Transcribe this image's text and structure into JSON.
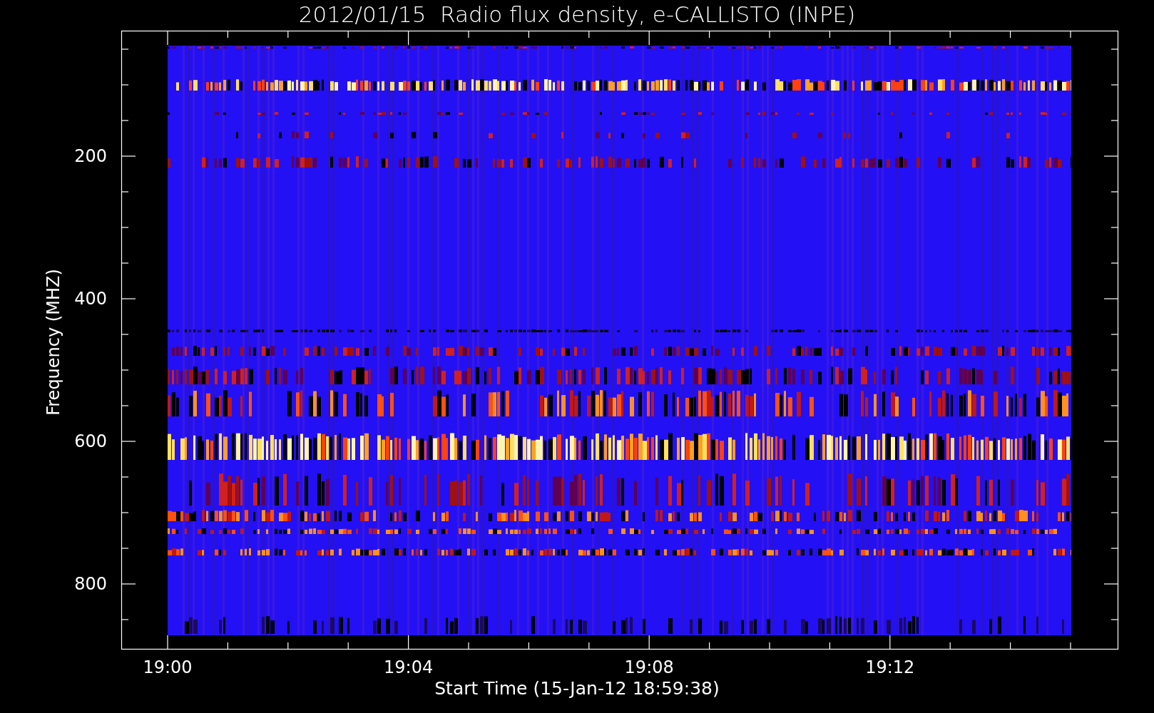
{
  "title": "2012/01/15  Radio flux density, e-CALLISTO (INPE)",
  "y_axis": {
    "label": "Frequency (MHZ)",
    "ticks": [
      "200",
      "400",
      "600",
      "800"
    ]
  },
  "x_axis": {
    "label": "Start Time (15-Jan-12 18:59:38)",
    "ticks": [
      "19:00",
      "19:04",
      "19:08",
      "19:12"
    ]
  }
}
